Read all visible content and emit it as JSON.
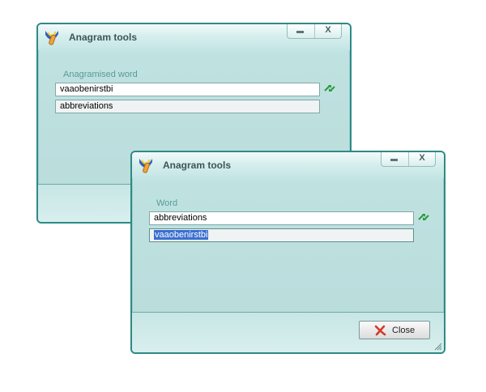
{
  "back_window": {
    "title": "Anagram tools",
    "field_label": "Anagramised word",
    "input_value": "vaaobenirstbi",
    "result_value": "abbreviations",
    "icons": [
      "app-icon",
      "swap-icon"
    ]
  },
  "front_window": {
    "title": "Anagram tools",
    "field_label": "Word",
    "input_value": "abbreviations",
    "result_value": "vaaobenirstbi",
    "close_label": "Close",
    "icons": [
      "app-icon",
      "swap-icon",
      "close-icon",
      "resize-grip-icon"
    ]
  },
  "window_controls": {
    "minimize": "minimize",
    "close": "X"
  },
  "colors": {
    "accent": "#2e8a86",
    "window_bg": "#bfe2e1",
    "label": "#5a9a98",
    "selection": "#3b6fd0",
    "close_x": "#d23a2a"
  }
}
